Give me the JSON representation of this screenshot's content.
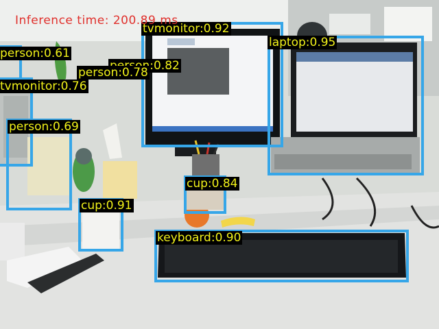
{
  "inference": {
    "text": "Inference time: 200.89 ms",
    "color": "#e0302c"
  },
  "style": {
    "box_color": "#36a6e8",
    "label_bg": "#000000",
    "label_fg": "#f2f21a"
  },
  "detections": [
    {
      "label": "tvmonitor:0.92"
    },
    {
      "label": "laptop:0.95"
    },
    {
      "label": "person:0.61"
    },
    {
      "label": "person:0.78"
    },
    {
      "label": "person:0.82"
    },
    {
      "label": "tvmonitor:0.76"
    },
    {
      "label": "person:0.69"
    },
    {
      "label": "cup:0.84"
    },
    {
      "label": "cup:0.91"
    },
    {
      "label": "keyboard:0.90"
    }
  ]
}
